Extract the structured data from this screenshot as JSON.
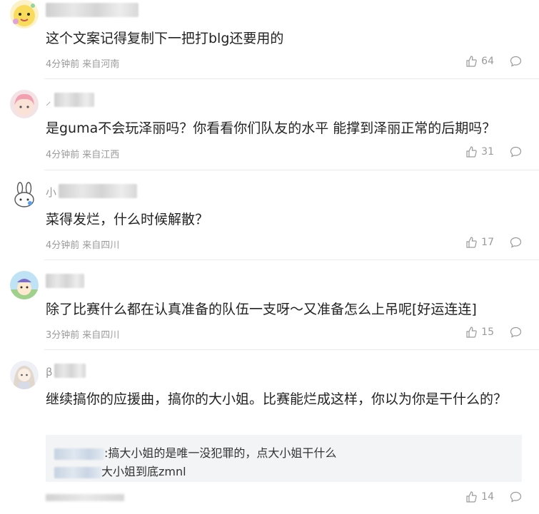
{
  "comments": [
    {
      "text": "这个文案记得复制下一把打blg还要用的",
      "time": "4分钟前",
      "location": "来自河南",
      "likes": "64"
    },
    {
      "text": "是guma不会玩泽丽吗？你看看你们队友的水平 能撑到泽丽正常的后期吗？",
      "time": "4分钟前",
      "location": "来自江西",
      "likes": "31"
    },
    {
      "text": "菜得发烂，什么时候解散？",
      "time": "4分钟前",
      "location": "来自四川",
      "likes": "17"
    },
    {
      "text": "除了比赛什么都在认真准备的队伍一支呀～又准备怎么上吊呢[好运连连]",
      "time": "3分钟前",
      "location": "来自四川",
      "likes": "15"
    },
    {
      "text": "继续搞你的应援曲，搞你的大小姐。比赛能烂成这样，你以为你是干什么的？",
      "likes": "14",
      "replies": [
        {
          "text": ":搞大小姐的是唯一没犯罪的，点大小姐干什么"
        },
        {
          "text": "大小姐到底zmnl"
        }
      ]
    }
  ],
  "icons": {
    "like": "thumbs-up-icon",
    "reply": "comment-bubble-icon"
  },
  "colors": {
    "meta_text": "#9a9a9a",
    "reply_bg": "#f3f4f5"
  }
}
